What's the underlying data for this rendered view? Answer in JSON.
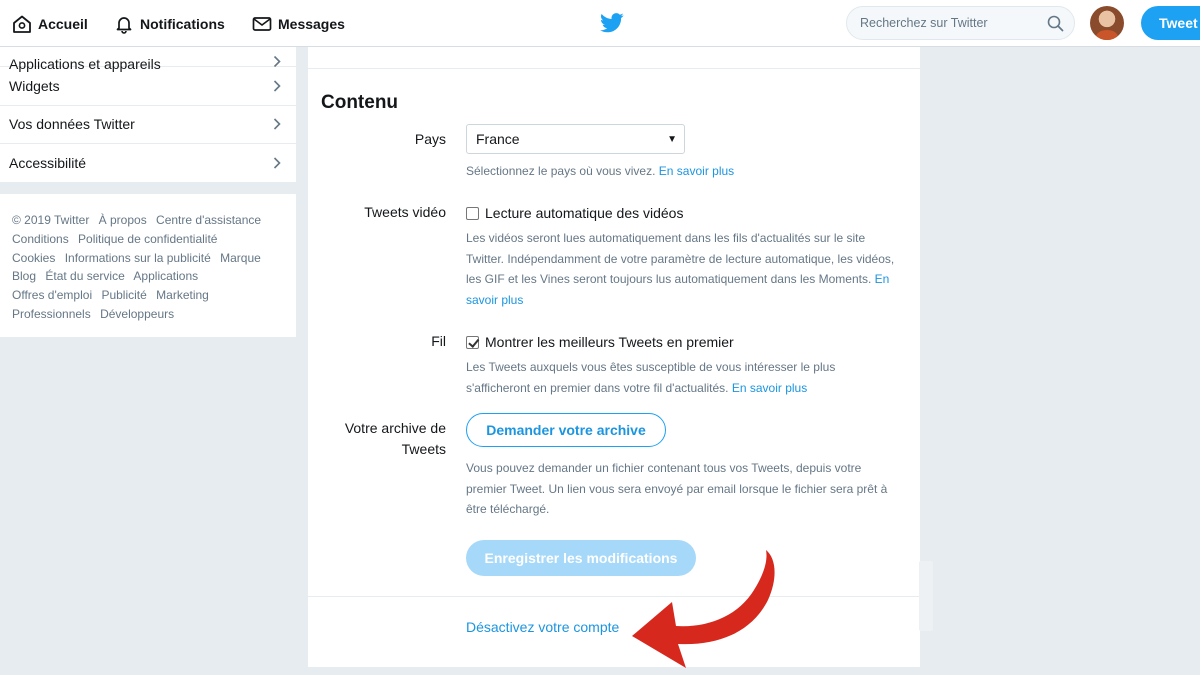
{
  "nav": {
    "home": "Accueil",
    "notifications": "Notifications",
    "messages": "Messages",
    "search_placeholder": "Recherchez sur Twitter",
    "tweet_button": "Tweet"
  },
  "sidebar": {
    "items": [
      {
        "label": "Applications et appareils"
      },
      {
        "label": "Widgets"
      },
      {
        "label": "Vos données Twitter"
      },
      {
        "label": "Accessibilité"
      }
    ]
  },
  "footer": {
    "links": [
      "© 2019 Twitter",
      "À propos",
      "Centre d'assistance",
      "Conditions",
      "Politique de confidentialité",
      "Cookies",
      "Informations sur la publicité",
      "Marque",
      "Blog",
      "État du service",
      "Applications",
      "Offres d'emploi",
      "Publicité",
      "Marketing",
      "Professionnels",
      "Développeurs"
    ]
  },
  "content": {
    "heading": "Contenu",
    "country": {
      "label": "Pays",
      "value": "France",
      "help": "Sélectionnez le pays où vous vivez.",
      "link": "En savoir plus"
    },
    "video": {
      "label": "Tweets vidéo",
      "checkbox_label": "Lecture automatique des vidéos",
      "checked": false,
      "help": "Les vidéos seront lues automatiquement dans les fils d'actualités sur le site Twitter. Indépendamment de votre paramètre de lecture automatique, les vidéos, les GIF et les Vines seront toujours lus automatiquement dans les Moments.",
      "link": "En savoir plus"
    },
    "feed": {
      "label": "Fil",
      "checkbox_label": "Montrer les meilleurs Tweets en premier",
      "checked": true,
      "help": "Les Tweets auxquels vous êtes susceptible de vous intéresser le plus s'afficheront en premier dans votre fil d'actualités.",
      "link": "En savoir plus"
    },
    "archive": {
      "label_line1": "Votre archive de",
      "label_line2": "Tweets",
      "button": "Demander votre archive",
      "help": "Vous pouvez demander un fichier contenant tous vos Tweets, depuis votre premier Tweet. Un lien vous sera envoyé par email lorsque le fichier sera prêt à être téléchargé."
    },
    "save_button": "Enregistrer les modifications",
    "deactivate_link": "Désactivez votre compte"
  },
  "colors": {
    "accent": "#1da1f2",
    "link": "#1b95e0",
    "annotation_arrow": "#d7281e"
  }
}
